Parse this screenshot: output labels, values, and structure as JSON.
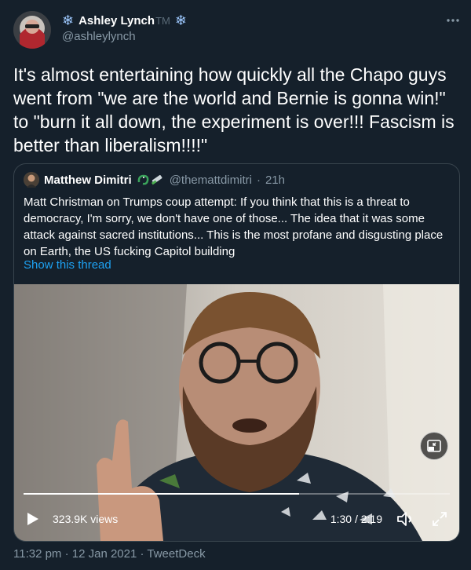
{
  "author": {
    "name": "Ashley Lynch",
    "tm": "TM",
    "handle": "@ashleylynch",
    "badge_icon": "snowflake-icon"
  },
  "tweet": {
    "text": "It's almost entertaining how quickly all the Chapo guys went from \"we are the world and Bernie is gonna win!\" to \"burn it all down, the experiment is over!!!  Fascism is better than liberalism!!!!\""
  },
  "quote": {
    "name": "Matthew Dimitri",
    "handle": "@themattdimitri",
    "separator": "·",
    "time": "21h",
    "text": "Matt Christman on Trumps coup attempt: If you think that this is a threat to democracy, I'm sorry, we don't have one of those... The idea that it was some attack against sacred institutions... This is the most profane and disgusting place on Earth, the US fucking Capitol building",
    "show_thread": "Show this thread"
  },
  "video": {
    "views": "323.9K views",
    "time": "1:30 / 2:19",
    "progress": 0.647
  },
  "meta": {
    "timestamp": "11:32 pm · 12 Jan 2021 · TweetDeck"
  },
  "colors": {
    "background": "#15202b",
    "link": "#1da1f2",
    "secondary": "#8899a6",
    "border": "#38444d"
  }
}
